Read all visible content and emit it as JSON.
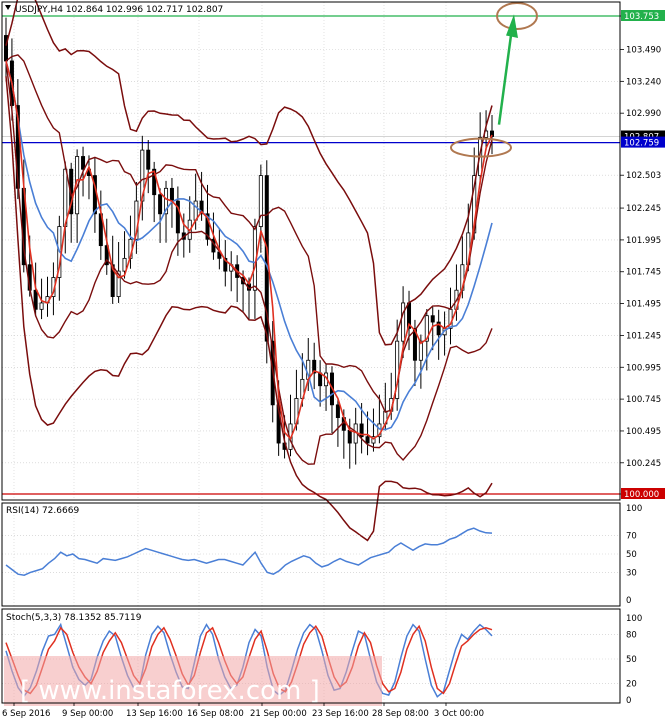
{
  "chart_data": [
    {
      "type": "candlestick",
      "title": "USDJPY,H4  102.864 102.996 102.717 102.807",
      "y_ticks": [
        103.753,
        103.49,
        103.24,
        102.99,
        102.503,
        102.245,
        101.995,
        101.745,
        101.495,
        101.245,
        100.995,
        100.745,
        100.495,
        100.245,
        100.0
      ],
      "y_tick_labels": [
        "103.753",
        "103.490",
        "103.240",
        "102.990",
        "102.503",
        "102.245",
        "101.995",
        "101.745",
        "101.495",
        "101.245",
        "100.995",
        "100.745",
        "100.495",
        "100.245",
        "100.000"
      ],
      "ylim": [
        100.0,
        103.85
      ],
      "x_labels": [
        "6 Sep 2016",
        "9 Sep 00:00",
        "13 Sep 16:00",
        "16 Sep 08:00",
        "21 Sep 00:00",
        "23 Sep 16:00",
        "28 Sep 08:00",
        "3 Oct 00:00"
      ],
      "price_tags": [
        {
          "label": "103.753",
          "value": 103.753,
          "color": "#22b14c"
        },
        {
          "label": "102.807",
          "value": 102.807,
          "color": "#000000"
        },
        {
          "label": "102.759",
          "value": 102.759,
          "color": "#0000cc"
        },
        {
          "label": "100.000",
          "value": 100.0,
          "color": "#cc0000"
        }
      ],
      "horizontal_lines": [
        {
          "value": 103.753,
          "color": "#22b14c"
        },
        {
          "value": 102.759,
          "color": "#0000cc"
        },
        {
          "value": 100.0,
          "color": "#cc0000"
        }
      ],
      "close": [
        103.4,
        103.05,
        102.4,
        101.8,
        101.6,
        101.45,
        101.5,
        101.55,
        101.7,
        102.1,
        102.55,
        102.2,
        102.65,
        102.55,
        102.5,
        102.2,
        101.95,
        101.8,
        101.55,
        101.75,
        101.85,
        102.0,
        102.3,
        102.7,
        102.55,
        102.35,
        102.2,
        102.4,
        102.3,
        102.05,
        102.0,
        102.15,
        102.3,
        102.2,
        102.0,
        101.9,
        101.85,
        101.75,
        101.8,
        101.7,
        101.65,
        101.6,
        102.1,
        102.5,
        101.2,
        100.7,
        100.4,
        100.35,
        100.55,
        100.75,
        100.9,
        101.05,
        100.95,
        100.85,
        100.95,
        100.7,
        100.6,
        100.5,
        100.4,
        100.55,
        100.45,
        100.4,
        100.45,
        100.55,
        100.65,
        100.75,
        101.2,
        101.5,
        101.3,
        101.05,
        101.2,
        101.4,
        101.35,
        101.25,
        101.3,
        101.45,
        101.6,
        101.8,
        102.05,
        102.5,
        102.8,
        102.85,
        102.807
      ]
    },
    {
      "type": "line",
      "title": "RSI(14) 72.6669",
      "y_ticks": [
        100,
        70,
        50,
        30,
        0
      ],
      "y_tick_labels": [
        "100",
        "70",
        "50",
        "30",
        "0"
      ],
      "ylim": [
        0,
        100
      ],
      "values": [
        38,
        33,
        28,
        27,
        30,
        32,
        34,
        40,
        45,
        52,
        48,
        50,
        45,
        44,
        42,
        40,
        45,
        44,
        43,
        45,
        47,
        50,
        53,
        56,
        54,
        52,
        50,
        48,
        46,
        44,
        43,
        44,
        42,
        40,
        42,
        44,
        44,
        42,
        40,
        38,
        45,
        52,
        40,
        30,
        28,
        32,
        38,
        42,
        45,
        48,
        46,
        40,
        36,
        38,
        42,
        45,
        42,
        40,
        38,
        42,
        46,
        48,
        50,
        52,
        58,
        62,
        58,
        54,
        58,
        61,
        60,
        60,
        62,
        66,
        68,
        72,
        76,
        78,
        75,
        73,
        72.6669
      ]
    },
    {
      "type": "line",
      "title": "Stoch(5,3,3) 78.1352 85.7119",
      "y_ticks": [
        100,
        80,
        50,
        20,
        0
      ],
      "y_tick_labels": [
        "100",
        "80",
        "50",
        "20",
        "0"
      ],
      "ylim": [
        0,
        100
      ],
      "series": [
        {
          "name": "",
          "color": "#e03020",
          "values": [
            70,
            50,
            30,
            12,
            8,
            18,
            40,
            62,
            72,
            88,
            80,
            58,
            40,
            28,
            20,
            35,
            58,
            72,
            82,
            70,
            50,
            30,
            20,
            38,
            65,
            80,
            88,
            74,
            54,
            32,
            18,
            30,
            58,
            82,
            88,
            70,
            48,
            30,
            20,
            28,
            52,
            74,
            84,
            60,
            32,
            14,
            10,
            22,
            44,
            68,
            82,
            90,
            78,
            52,
            28,
            16,
            22,
            40,
            66,
            82,
            70,
            42,
            20,
            10,
            14,
            34,
            62,
            80,
            90,
            72,
            40,
            14,
            8,
            20,
            44,
            66,
            72,
            80,
            86,
            88,
            85.7119
          ]
        },
        {
          "name": "",
          "color": "#4a7fd6",
          "values": [
            60,
            35,
            15,
            5,
            15,
            35,
            60,
            78,
            80,
            92,
            66,
            40,
            25,
            18,
            25,
            52,
            72,
            84,
            78,
            52,
            30,
            15,
            18,
            55,
            80,
            90,
            82,
            56,
            34,
            16,
            14,
            45,
            78,
            92,
            80,
            50,
            28,
            14,
            18,
            40,
            70,
            86,
            78,
            40,
            12,
            6,
            12,
            36,
            62,
            82,
            92,
            86,
            60,
            30,
            12,
            14,
            34,
            60,
            84,
            80,
            50,
            22,
            8,
            6,
            22,
            52,
            78,
            92,
            84,
            50,
            18,
            4,
            10,
            36,
            62,
            80,
            74,
            84,
            92,
            86,
            78.1352
          ]
        }
      ]
    }
  ],
  "watermark": "[ www.instaforex.com ]"
}
